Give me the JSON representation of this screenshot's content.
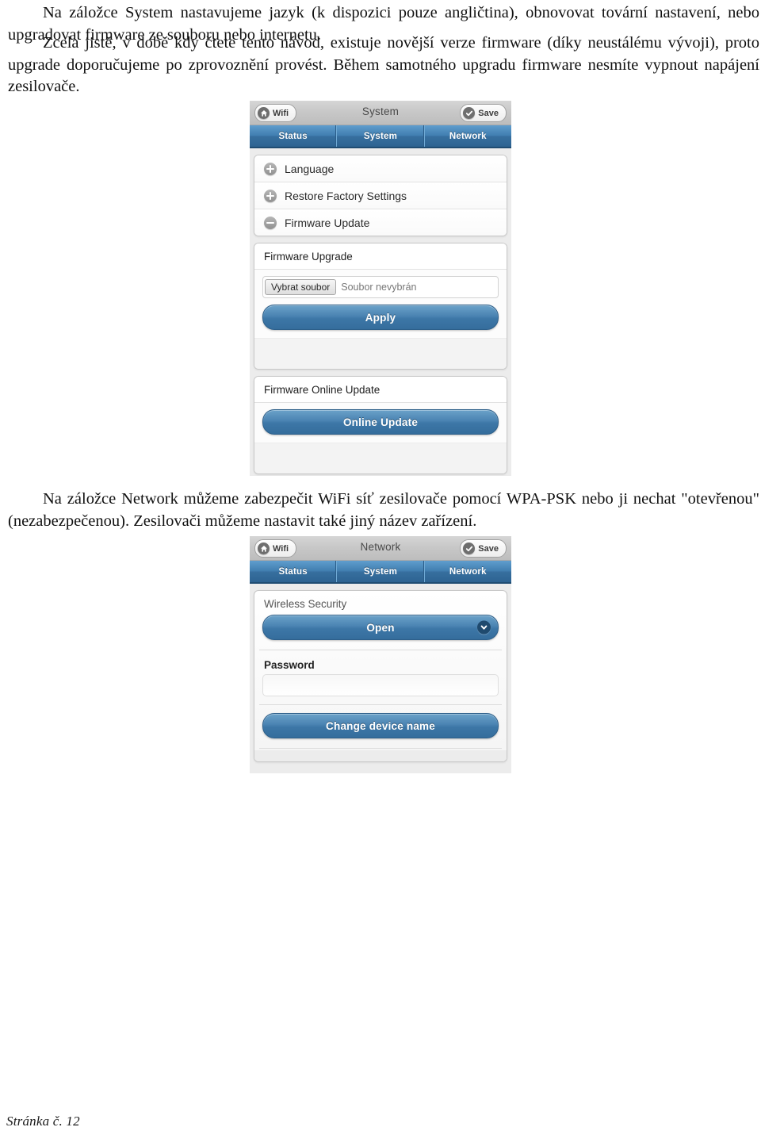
{
  "document": {
    "paragraph_1": "Na záložce System nastavujeme jazyk (k dispozici pouze angličtina), obnovovat tovární nastavení, nebo upgradovat firmware ze souboru nebo internetu.",
    "paragraph_2": "Zcela jistě, v době kdy čtete tento návod, existuje novější verze firmware (díky neustálému vývoji), proto upgrade doporučujeme po zprovoznění provést. Během samotného upgradu firmware nesmíte vypnout napájení zesilovače.",
    "paragraph_3": "Na záložce Network můžeme zabezpečit WiFi síť zesilovače pomocí WPA-PSK nebo ji nechat \"otevřenou\" (nezabezpečenou). Zesilovači můžeme nastavit také jiný název zařízení.",
    "footer": "Stránka č. 12"
  },
  "colors": {
    "tab_blue": "#417eb0",
    "button_blue": "#4a83b2",
    "topbar_gray": "#c7c7c7",
    "panel_gray": "#ececec"
  },
  "system_screen": {
    "topbar": {
      "left_button_label": "Wifi",
      "left_button_icon": "home-icon",
      "title": "System",
      "right_button_label": "Save",
      "right_button_icon": "check-circle-icon"
    },
    "tabs": [
      {
        "label": "Status",
        "active": false
      },
      {
        "label": "System",
        "active": true
      },
      {
        "label": "Network",
        "active": false
      }
    ],
    "accordion": [
      {
        "label": "Language",
        "icon": "plus-circle-icon",
        "expanded": false
      },
      {
        "label": "Restore Factory Settings",
        "icon": "plus-circle-icon",
        "expanded": false
      },
      {
        "label": "Firmware Update",
        "icon": "minus-circle-icon",
        "expanded": true
      }
    ],
    "firmware_upgrade": {
      "heading": "Firmware Upgrade",
      "file_button_label": "Vybrat soubor",
      "file_status": "Soubor nevybrán",
      "apply_label": "Apply"
    },
    "firmware_online_update": {
      "heading": "Firmware Online Update",
      "button_label": "Online Update"
    }
  },
  "network_screen": {
    "topbar": {
      "left_button_label": "Wifi",
      "left_button_icon": "home-icon",
      "title": "Network",
      "right_button_label": "Save",
      "right_button_icon": "check-circle-icon"
    },
    "tabs": [
      {
        "label": "Status",
        "active": false
      },
      {
        "label": "System",
        "active": false
      },
      {
        "label": "Network",
        "active": true
      }
    ],
    "wireless_security": {
      "label": "Wireless Security",
      "selected_option": "Open",
      "dropdown_icon": "chevron-down-icon"
    },
    "password": {
      "label": "Password",
      "value": "",
      "placeholder": ""
    },
    "change_device_name_label": "Change device name"
  }
}
